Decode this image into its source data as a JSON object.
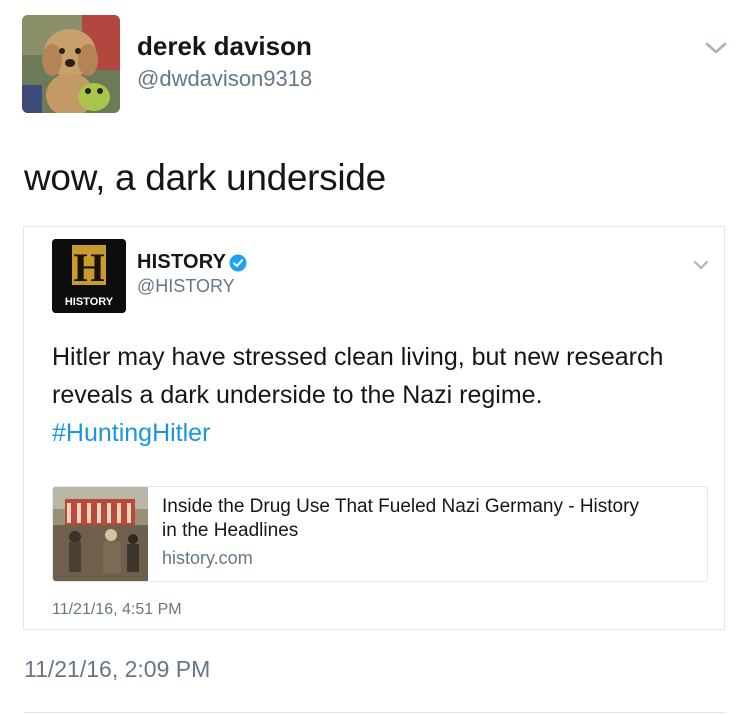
{
  "tweet": {
    "author_name": "derek davison",
    "author_handle": "@dwdavison9318",
    "text": "wow, a dark underside",
    "timestamp": "11/21/16, 2:09 PM"
  },
  "quoted_tweet": {
    "author_name": "HISTORY",
    "author_handle": "@HISTORY",
    "logo_letter": "H",
    "logo_caption": "HISTORY",
    "text_lines": [
      "Hitler may have stressed clean living, but new research",
      "reveals a dark underside to the Nazi regime."
    ],
    "hashtag": "#HuntingHitler",
    "timestamp": "11/21/16, 4:51 PM",
    "card": {
      "title_lines": [
        "Inside the Drug Use That Fueled Nazi Germany - History",
        "in the Headlines"
      ],
      "domain": "history.com"
    }
  },
  "colors": {
    "link": "#1b95e0",
    "muted": "#657786",
    "verified": "#1da1f2",
    "border": "#e1e8ed"
  },
  "icons": {
    "menu": "chevron-down-icon",
    "verified": "verified-badge-icon"
  }
}
